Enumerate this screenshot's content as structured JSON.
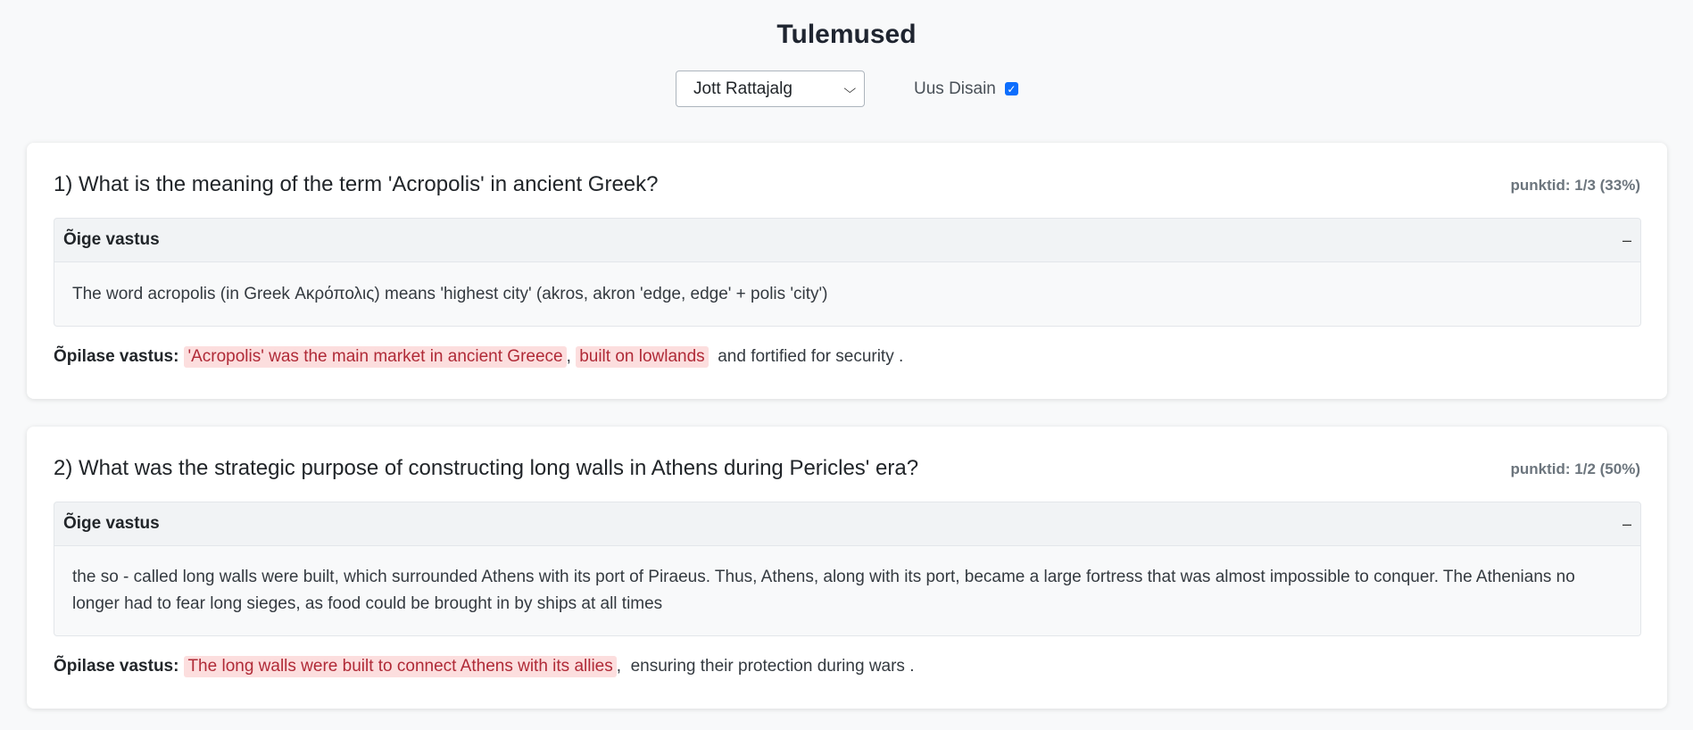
{
  "header": {
    "title": "Tulemused",
    "student_select": "Jott Rattajalg",
    "toggle_label": "Uus Disain",
    "toggle_checked": true
  },
  "colors": {
    "accent": "#0d6efd",
    "wrong_bg": "#fcdede",
    "wrong_text": "#b02a37"
  },
  "questions": [
    {
      "title": "1) What is the meaning of the term 'Acropolis' in ancient Greek?",
      "points": "punktid: 1/3 (33%)",
      "correct_label": "Õige vastus",
      "collapse_icon": "–",
      "correct_answer": "The word acropolis (in Greek Ακρόπολις) means 'highest city' (akros, akron 'edge, edge' + polis 'city')",
      "student_label": "Õpilase vastus:",
      "student_parts": [
        {
          "text": "'Acropolis' was the main market in ancient Greece",
          "wrong": true
        },
        {
          "text": ", ",
          "wrong": false
        },
        {
          "text": "built on lowlands",
          "wrong": true
        },
        {
          "text": "  and fortified for security .",
          "wrong": false
        }
      ]
    },
    {
      "title": "2) What was the strategic purpose of constructing long walls in Athens during Pericles' era?",
      "points": "punktid: 1/2 (50%)",
      "correct_label": "Õige vastus",
      "collapse_icon": "–",
      "correct_answer": "the so - called long walls were built, which surrounded Athens with its port of Piraeus. Thus, Athens, along with its port, became a large fortress that was almost impossible to conquer. The Athenians no longer had to fear long sieges, as food could be brought in by ships at all times",
      "student_label": "Õpilase vastus:",
      "student_parts": [
        {
          "text": "The long walls were built to connect Athens with its allies",
          "wrong": true
        },
        {
          "text": ",  ensuring their protection during wars .",
          "wrong": false
        }
      ]
    }
  ]
}
